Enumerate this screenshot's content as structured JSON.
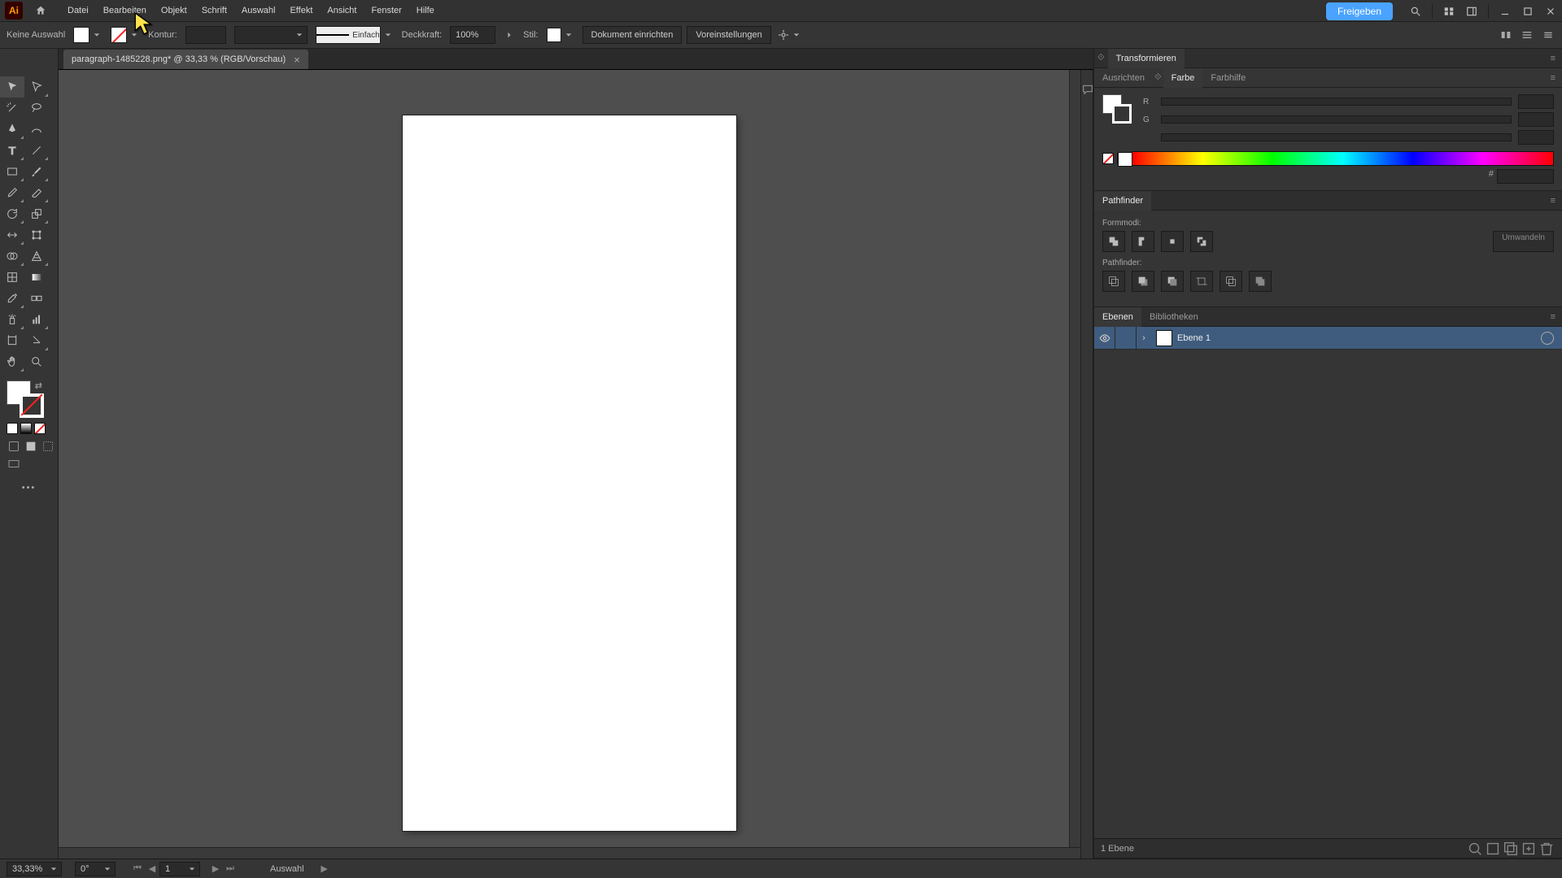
{
  "menu": {
    "items": [
      "Datei",
      "Bearbeiten",
      "Objekt",
      "Schrift",
      "Auswahl",
      "Effekt",
      "Ansicht",
      "Fenster",
      "Hilfe"
    ]
  },
  "share_label": "Freigeben",
  "ctrl": {
    "no_selection": "Keine Auswahl",
    "stroke_label": "Kontur:",
    "stroke_val": "",
    "brush_style": "Einfach",
    "opacity_label": "Deckkraft:",
    "opacity_val": "100%",
    "style_label": "Stil:",
    "doc_setup": "Dokument einrichten",
    "prefs": "Voreinstellungen"
  },
  "tab": {
    "title": "paragraph-1485228.png* @ 33,33 % (RGB/Vorschau)"
  },
  "panels": {
    "transform_tab": "Transformieren",
    "align_tab": "Ausrichten",
    "color_tab": "Farbe",
    "colorguide_tab": "Farbhilfe",
    "color": {
      "r_lbl": "R",
      "g_lbl": "G",
      "b_lbl": "",
      "hex_lbl": "#"
    },
    "pathfinder_tab": "Pathfinder",
    "pf_shapemodes": "Formmodi:",
    "pf_pathfinders": "Pathfinder:",
    "pf_expand": "Umwandeln",
    "layers_tab": "Ebenen",
    "libraries_tab": "Bibliotheken",
    "layer1": "Ebene 1",
    "layer_count": "1 Ebene"
  },
  "status": {
    "zoom": "33,33%",
    "rotate": "0°",
    "artboard": "1",
    "tool": "Auswahl"
  }
}
